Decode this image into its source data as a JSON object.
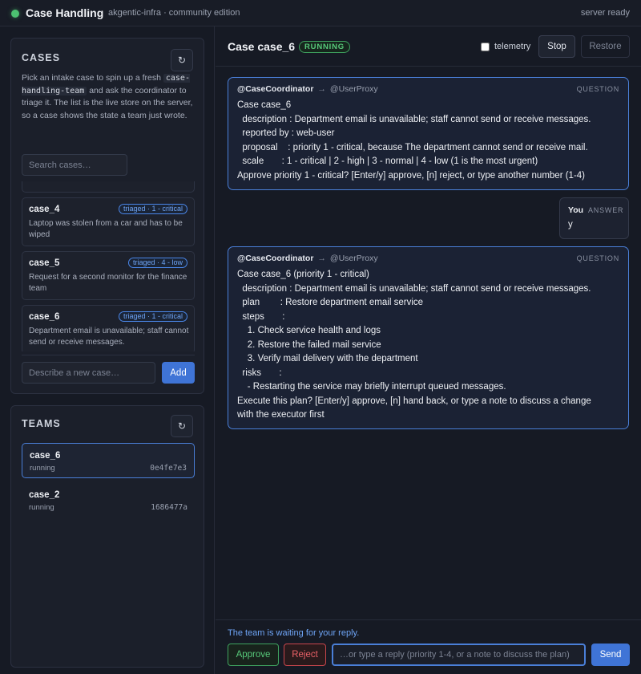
{
  "header": {
    "title": "Case Handling",
    "subtitle": "akgentic-infra · community edition",
    "server_status": "server ready",
    "status_color": "#4cc271"
  },
  "cases_panel": {
    "title": "CASES",
    "refresh_icon": "refresh-icon",
    "refresh_label": "↻",
    "intro_1": "Pick an intake case to spin up a fresh",
    "intro_code": "case-handling-team",
    "intro_2": "and ask the coordinator to triage it. The list is the live store on the server, so a case shows the state a team just wrote.",
    "search_placeholder": "Search cases…",
    "items": [
      {
        "id": "case_4",
        "badge": "triaged · 1 - critical",
        "description": "Laptop was stolen from a car and has to be wiped"
      },
      {
        "id": "case_5",
        "badge": "triaged · 4 - low",
        "description": "Request for a second monitor for the finance team"
      },
      {
        "id": "case_6",
        "badge": "triaged · 1 - critical",
        "description": "Department email is unavailable; staff cannot send or receive messages."
      }
    ],
    "new_case_placeholder": "Describe a new case…",
    "add_label": "Add"
  },
  "teams_panel": {
    "title": "TEAMS",
    "refresh_label": "↻",
    "items": [
      {
        "name": "case_6",
        "status": "running",
        "hash": "0e4fe7e3",
        "active": true
      },
      {
        "name": "case_2",
        "status": "running",
        "hash": "1686477a",
        "active": false
      }
    ]
  },
  "main": {
    "case_title": "Case case_6",
    "status": "RUNNING",
    "telemetry_label": "telemetry",
    "telemetry_checked": false,
    "stop_label": "Stop",
    "restore_label": "Restore",
    "messages": [
      {
        "from": "@CaseCoordinator",
        "arrow": "→",
        "to": "@UserProxy",
        "kind": "QUESTION",
        "body": "Case case_6\n  description : Department email is unavailable; staff cannot send or receive messages.\n  reported by : web-user\n  proposal    : priority 1 - critical, because The department cannot send or receive mail.\n  scale       : 1 - critical | 2 - high | 3 - normal | 4 - low (1 is the most urgent)\nApprove priority 1 - critical? [Enter/y] approve, [n] reject, or type another number (1-4)"
      },
      {
        "from": "@CaseCoordinator",
        "arrow": "→",
        "to": "@UserProxy",
        "kind": "QUESTION",
        "body": "Case case_6 (priority 1 - critical)\n  description : Department email is unavailable; staff cannot send or receive messages.\n  plan        : Restore department email service\n  steps       :\n    1. Check service health and logs\n    2. Restore the failed mail service\n    3. Verify mail delivery with the department\n  risks       :\n    - Restarting the service may briefly interrupt queued messages.\nExecute this plan? [Enter/y] approve, [n] hand back, or type a note to discuss a change\nwith the executor first"
      }
    ],
    "answer": {
      "author": "You",
      "kind": "ANSWER",
      "text": "y"
    },
    "footer": {
      "waiting_text": "The team is waiting for your reply.",
      "approve_label": "Approve",
      "reject_label": "Reject",
      "reply_placeholder": "…or type a reply (priority 1-4, or a note to discuss the plan)",
      "send_label": "Send"
    }
  }
}
